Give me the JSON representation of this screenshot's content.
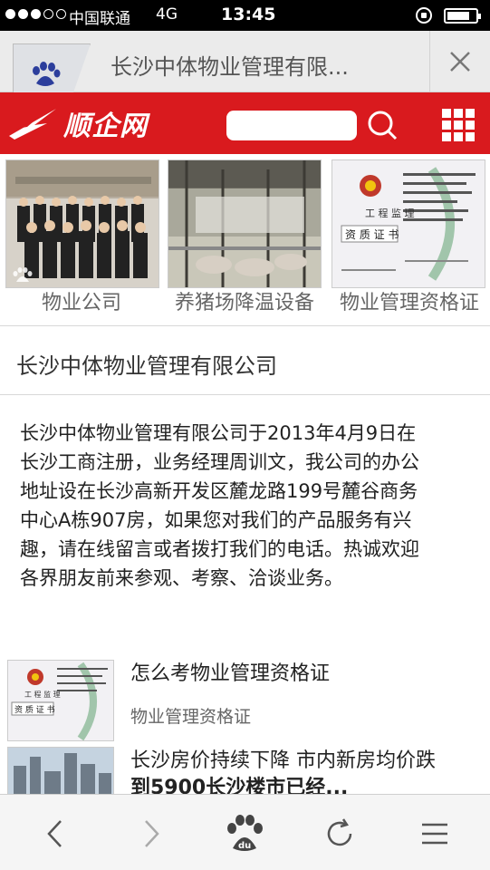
{
  "status_bar": {
    "carrier": "中国联通",
    "network": "4G",
    "time": "13:45",
    "signal_level": 3,
    "signal_max": 5,
    "battery_fraction": 0.8
  },
  "browser": {
    "tab_title": "长沙中体物业管理有限..."
  },
  "site": {
    "logo_text": "顺企网",
    "brand_color": "#d91a1e"
  },
  "categories": [
    {
      "caption": "物业公司"
    },
    {
      "caption": "养猪场降温设备"
    },
    {
      "caption": "物业管理资格证"
    }
  ],
  "certificate": {
    "small_lines": "工 程 监 理",
    "title": "资 质 证 书"
  },
  "company": {
    "name": "长沙中体物业管理有限公司",
    "description_lines": [
      "长沙中体物业管理有限公司于2013年4月9日在",
      "长沙工商注册，业务经理周训文，我公司的办公",
      "地址设在长沙高新开发区麓龙路199号麓谷商务",
      "中心A栋907房，如果您对我们的产品服务有兴",
      "趣，请在线留言或者拨打我们的电话。热诚欢迎",
      "各界朋友前来参观、考察、洽谈业务。"
    ]
  },
  "articles": [
    {
      "title": "怎么考物业管理资格证",
      "subtitle": "物业管理资格证"
    },
    {
      "title_lines": [
        "长沙房价持续下降 市内新房均价跌",
        "到5900长沙楼市已经..."
      ]
    }
  ],
  "toolbar": {
    "icons": [
      "back-icon",
      "forward-icon",
      "baidu-paw-icon",
      "refresh-icon",
      "menu-icon"
    ],
    "baidu_label": "du"
  }
}
